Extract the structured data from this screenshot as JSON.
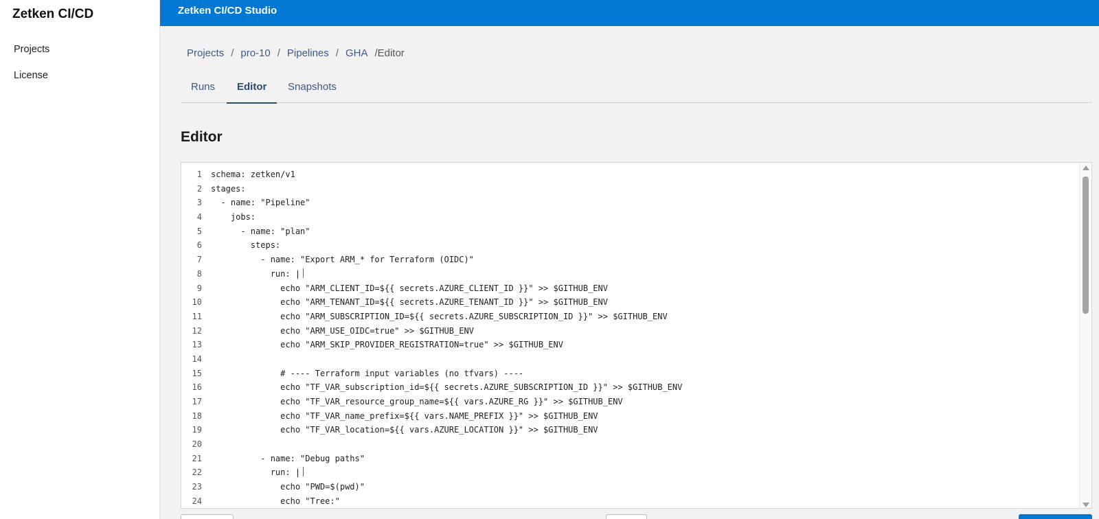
{
  "sidebar": {
    "brand": "Zetken CI/CD",
    "items": [
      {
        "label": "Projects"
      },
      {
        "label": "License"
      }
    ]
  },
  "topbar": {
    "title": "Zetken CI/CD Studio"
  },
  "breadcrumb": {
    "items": [
      "Projects",
      "pro-10",
      "Pipelines",
      "GHA"
    ],
    "separator": "/",
    "current": "/Editor"
  },
  "tabs": [
    {
      "label": "Runs",
      "active": false
    },
    {
      "label": "Editor",
      "active": true
    },
    {
      "label": "Snapshots",
      "active": false
    }
  ],
  "section": {
    "title": "Editor"
  },
  "editor": {
    "lines": [
      "schema: zetken/v1",
      "stages:",
      "  - name: \"Pipeline\"",
      "    jobs:",
      "      - name: \"plan\"",
      "        steps:",
      "          - name: \"Export ARM_* for Terraform (OIDC)\"",
      "            run: |",
      "              echo \"ARM_CLIENT_ID=${{ secrets.AZURE_CLIENT_ID }}\" >> $GITHUB_ENV",
      "              echo \"ARM_TENANT_ID=${{ secrets.AZURE_TENANT_ID }}\" >> $GITHUB_ENV",
      "              echo \"ARM_SUBSCRIPTION_ID=${{ secrets.AZURE_SUBSCRIPTION_ID }}\" >> $GITHUB_ENV",
      "              echo \"ARM_USE_OIDC=true\" >> $GITHUB_ENV",
      "              echo \"ARM_SKIP_PROVIDER_REGISTRATION=true\" >> $GITHUB_ENV",
      "",
      "              # ---- Terraform input variables (no tfvars) ----",
      "              echo \"TF_VAR_subscription_id=${{ secrets.AZURE_SUBSCRIPTION_ID }}\" >> $GITHUB_ENV",
      "              echo \"TF_VAR_resource_group_name=${{ vars.AZURE_RG }}\" >> $GITHUB_ENV",
      "              echo \"TF_VAR_name_prefix=${{ vars.NAME_PREFIX }}\" >> $GITHUB_ENV",
      "              echo \"TF_VAR_location=${{ vars.AZURE_LOCATION }}\" >> $GITHUB_ENV",
      "",
      "          - name: \"Debug paths\"",
      "            run: |",
      "              echo \"PWD=$(pwd)\"",
      "              echo \"Tree:\""
    ]
  },
  "colors": {
    "accent": "#0078d4",
    "link": "#3a5a8c",
    "cursor": "#c0392b"
  }
}
